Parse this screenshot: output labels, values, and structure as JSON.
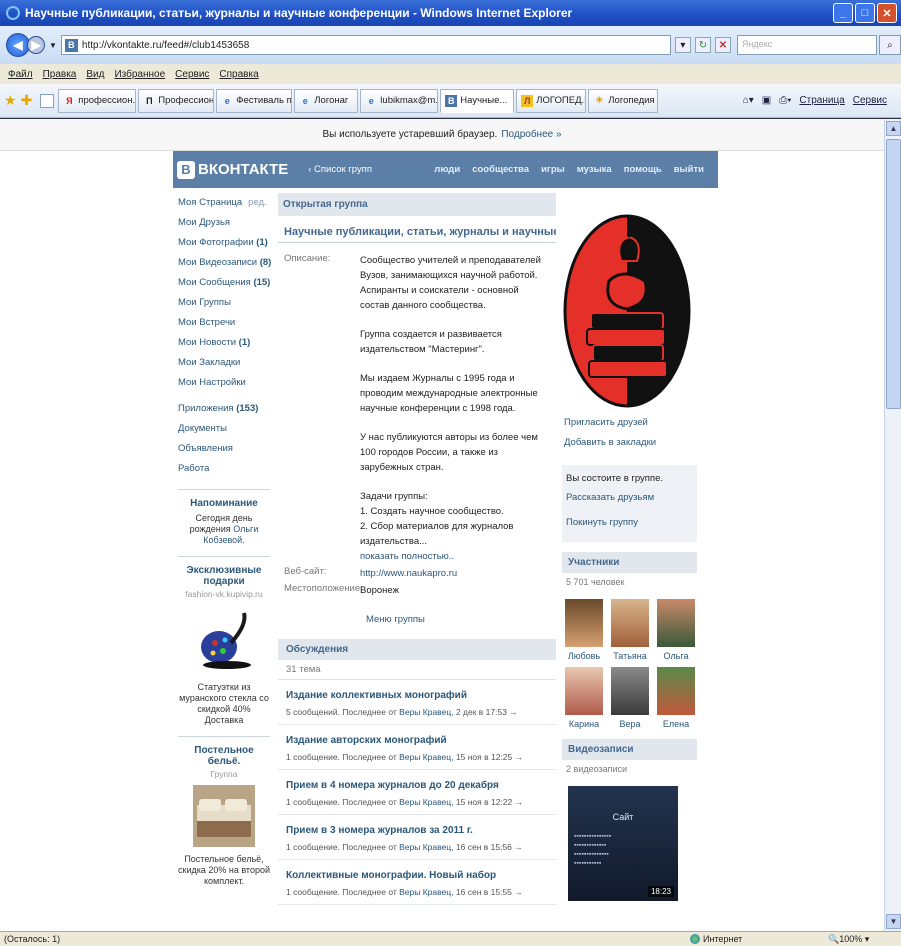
{
  "browser": {
    "title": "Научные публикации, статьи, журналы и научные конференции - Windows Internet Explorer",
    "url": "http://vkontakte.ru/feed#/club1453658",
    "search_placeholder": "Яндекс",
    "menu": [
      "Файл",
      "Правка",
      "Вид",
      "Избранное",
      "Сервис",
      "Справка"
    ],
    "tabs": [
      {
        "label": "профессион...",
        "icon": "yandex-icon"
      },
      {
        "label": "Профессион...",
        "icon": "p-icon"
      },
      {
        "label": "Фестиваль п...",
        "icon": "ie-icon"
      },
      {
        "label": "Логонаг",
        "icon": "ie-icon"
      },
      {
        "label": "lubikmax@m...",
        "icon": "ie-icon"
      },
      {
        "label": "Научные...",
        "icon": "vk-icon",
        "active": true
      },
      {
        "label": "ЛОГОПЕД.Р...",
        "icon": "logoped-icon"
      },
      {
        "label": "Логопедия ...",
        "icon": "sun-icon"
      }
    ],
    "commands": {
      "page": "Страница",
      "service": "Сервис"
    },
    "status_left": "(Осталось: 1)",
    "status_zone": "Интернет",
    "status_zoom": "100%"
  },
  "infobar": {
    "text": "Вы используете устаревший браузер.",
    "link": "Подробнее »"
  },
  "vk": {
    "logo": "ВКОНТАКТЕ",
    "groups_link": "‹ Список групп",
    "nav": [
      "люди",
      "сообщества",
      "игры",
      "музыка",
      "помощь",
      "выйти"
    ]
  },
  "left": {
    "my_page": "Моя Страница",
    "edit": "ред.",
    "links": [
      {
        "label": "Мои Друзья",
        "count": ""
      },
      {
        "label": "Мои Фотографии",
        "count": "(1)"
      },
      {
        "label": "Мои Видеозаписи",
        "count": "(8)"
      },
      {
        "label": "Мои Сообщения",
        "count": "(15)"
      },
      {
        "label": "Мои Группы",
        "count": ""
      },
      {
        "label": "Мои Встречи",
        "count": ""
      },
      {
        "label": "Мои Новости",
        "count": "(1)"
      },
      {
        "label": "Мои Закладки",
        "count": ""
      },
      {
        "label": "Мои Настройки",
        "count": ""
      }
    ],
    "links2": [
      {
        "label": "Приложения",
        "count": "(153)"
      },
      {
        "label": "Документы",
        "count": ""
      },
      {
        "label": "Объявления",
        "count": ""
      },
      {
        "label": "Работа",
        "count": ""
      }
    ],
    "reminder": {
      "title": "Напоминание",
      "pre": "Сегодня",
      "mid": "день рождения",
      "name": "Ольги Кобзевой."
    },
    "gifts": {
      "title": "Эксклюзивные подарки",
      "site": "fashion-vk.kupivip.ru",
      "text": "Статуэтки из муранского стекла со скидкой 40% Доставка"
    },
    "ad": {
      "title": "Постельное бельё.",
      "sub": "Группа",
      "text": "Постельное бельё, скидка 20% на второй комплект."
    }
  },
  "main": {
    "group_type": "Открытая группа",
    "group_name": "Научные публикации, статьи, журналы и научные конференц",
    "desc_label": "Описание:",
    "desc": [
      "Сообщество учителей и преподавателей Вузов, занимающихся научной работой. Аспиранты и соискатели - основной состав данного сообщества.",
      "Группа создается и развивается издательством \"Мастеринг\".",
      "Мы издаем Журналы с 1995 года и проводим международные электронные научные конференции с 1998 года.",
      "У нас публикуются авторы из более чем 100 городов России, а также из зарубежных стран."
    ],
    "tasks_title": "Задачи группы:",
    "tasks": [
      "1. Создать научное сообщество.",
      "2. Сбор материалов для журналов издательства..."
    ],
    "show_full": "показать полностью..",
    "site_label": "Веб-сайт:",
    "site": "http://www.naukapro.ru",
    "location_label": "Местоположение:",
    "location": "Воронеж",
    "group_menu": "Меню группы",
    "discussions": "Обсуждения",
    "disc_count": "31 тема",
    "topics": [
      {
        "title": "Издание коллективных монографий",
        "meta": "5 сообщений. Последнее от",
        "author": "Веры Кравец,",
        "date": "2 дек в 17:53 →"
      },
      {
        "title": "Издание авторских монографий",
        "meta": "1 сообщение. Последнее от",
        "author": "Веры Кравец,",
        "date": "15 ноя в 12:25 →"
      },
      {
        "title": "Прием в 4 номера журналов до 20 декабря",
        "meta": "1 сообщение. Последнее от",
        "author": "Веры Кравец,",
        "date": "15 ноя в 12:22 →"
      },
      {
        "title": "Прием в 3 номера журналов за 2011 г.",
        "meta": "1 сообщение. Последнее от",
        "author": "Веры Кравец,",
        "date": "16 сен в 15:56 →"
      },
      {
        "title": "Коллективные монографии. Новый набор",
        "meta": "1 сообщение. Последнее от",
        "author": "Веры Кравец,",
        "date": "16 сен в 15:55 →"
      }
    ]
  },
  "right": {
    "invite": "Пригласить друзей",
    "bookmark": "Добавить в закладки",
    "member_status": "Вы состоите в группе.",
    "tell_friends": "Рассказать друзьям",
    "leave": "Покинуть группу",
    "participants": "Участники",
    "participants_count": "5 701 человек",
    "members": [
      "Любовь",
      "Татьяна",
      "Ольга",
      "Карина",
      "Вера",
      "Елена"
    ],
    "videos": "Видеозаписи",
    "videos_count": "2 видеозаписи",
    "video_title": "Сайт",
    "video_duration": "18:23"
  },
  "colors": {
    "vk_blue": "#5b7fa6",
    "link": "#2b587a",
    "header_bg": "#e1e7ed",
    "avatar_red": "#e5302a"
  }
}
